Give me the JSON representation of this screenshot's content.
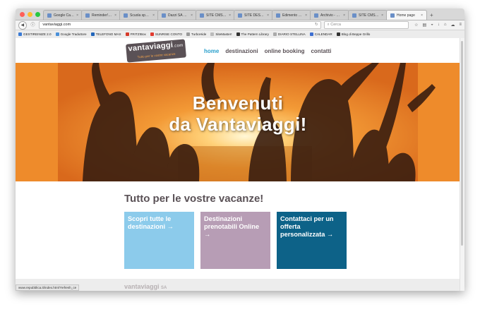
{
  "browser": {
    "tabs": [
      {
        "label": "Google Calend...",
        "active": false
      },
      {
        "label": "Reminder! - Associ...",
        "active": false
      },
      {
        "label": "Scuola speciali...",
        "active": false
      },
      {
        "label": "Dazzi SA Chim...",
        "active": false
      },
      {
        "label": "SITE CMS - ww...",
        "active": false
      },
      {
        "label": "SITE DESIGN",
        "active": false
      },
      {
        "label": "Edimento Dato...",
        "active": false
      },
      {
        "label": "Archivio - Wau...",
        "active": false
      },
      {
        "label": "SITE CMS - ww...",
        "active": false
      },
      {
        "label": "Home page",
        "active": true
      }
    ],
    "url": "vantaviaggi.com",
    "search_placeholder": "Cerca",
    "bookmarks": [
      {
        "label": "GESTIREINIZE 2.0",
        "color": "#3a7bd5"
      },
      {
        "label": "Google Traduttore",
        "color": "#4a90d9"
      },
      {
        "label": "TELEFONO MAX",
        "color": "#2266bb"
      },
      {
        "label": "FRITZ!Box",
        "color": "#d63a2a"
      },
      {
        "label": "SUNRISE CONTO",
        "color": "#e23a2f"
      },
      {
        "label": "TurboHide",
        "color": "#999999"
      },
      {
        "label": "SiteMaster!",
        "color": "#bbbbbb"
      },
      {
        "label": "The Pattern Library",
        "color": "#333333"
      },
      {
        "label": "DIARIO STELLINA",
        "color": "#aaaaaa"
      },
      {
        "label": "CALENDAR",
        "color": "#3d6fd1"
      },
      {
        "label": "Blog di Beppe Grillo",
        "color": "#333333"
      }
    ],
    "status_url": "www.repubblica.it/index.html?refresh_ce"
  },
  "site": {
    "logo_name": "vantaviaggi",
    "logo_suffix": ".com",
    "logo_tagline": "Tutto per le vostre vacanze",
    "menu": [
      {
        "label": "home",
        "active": true
      },
      {
        "label": "destinazioni",
        "active": false
      },
      {
        "label": "online booking",
        "active": false
      },
      {
        "label": "contatti",
        "active": false
      }
    ],
    "hero_line1": "Benvenuti",
    "hero_line2": "da Vantaviaggi!",
    "section_title": "Tutto per le vostre vacanze!",
    "boxes": [
      {
        "text": "Scopri tutte le destinazioni →",
        "color": "#8ccbeb"
      },
      {
        "text": "Destinazioni prenotabili Online →",
        "color": "#b79db5"
      },
      {
        "text": "Contattaci per un offerta personalizzata →",
        "color": "#0d6288"
      }
    ],
    "footer_logo": "vantaviaggi",
    "footer_logo_suffix": "SA"
  },
  "colors": {
    "accent": "#2ba0cc",
    "brand": "#5a5156",
    "hero_orange": "#ee8b2b"
  }
}
